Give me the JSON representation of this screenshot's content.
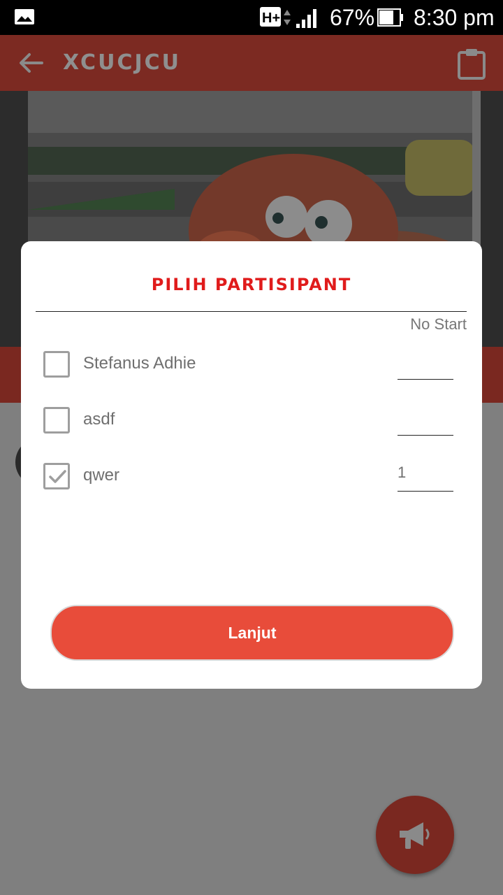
{
  "status_bar": {
    "network": "H+",
    "battery_percent": "67%",
    "time": "8:30 pm"
  },
  "app_bar": {
    "title": "XCUCJCU",
    "back_icon": "arrow-left-icon",
    "action_icon": "clipboard-icon"
  },
  "dialog": {
    "title": "PILIH PARTISIPANT",
    "column_header": "No Start",
    "participants": [
      {
        "name": "Stefanus Adhie",
        "checked": false,
        "start_no": ""
      },
      {
        "name": "asdf",
        "checked": false,
        "start_no": ""
      },
      {
        "name": "qwer",
        "checked": true,
        "start_no": "1"
      }
    ],
    "continue_label": "Lanjut"
  },
  "fab": {
    "icon": "megaphone-icon"
  },
  "colors": {
    "accent": "#e84c3a",
    "title_red": "#e01b1b",
    "app_bar": "#c0392b"
  }
}
